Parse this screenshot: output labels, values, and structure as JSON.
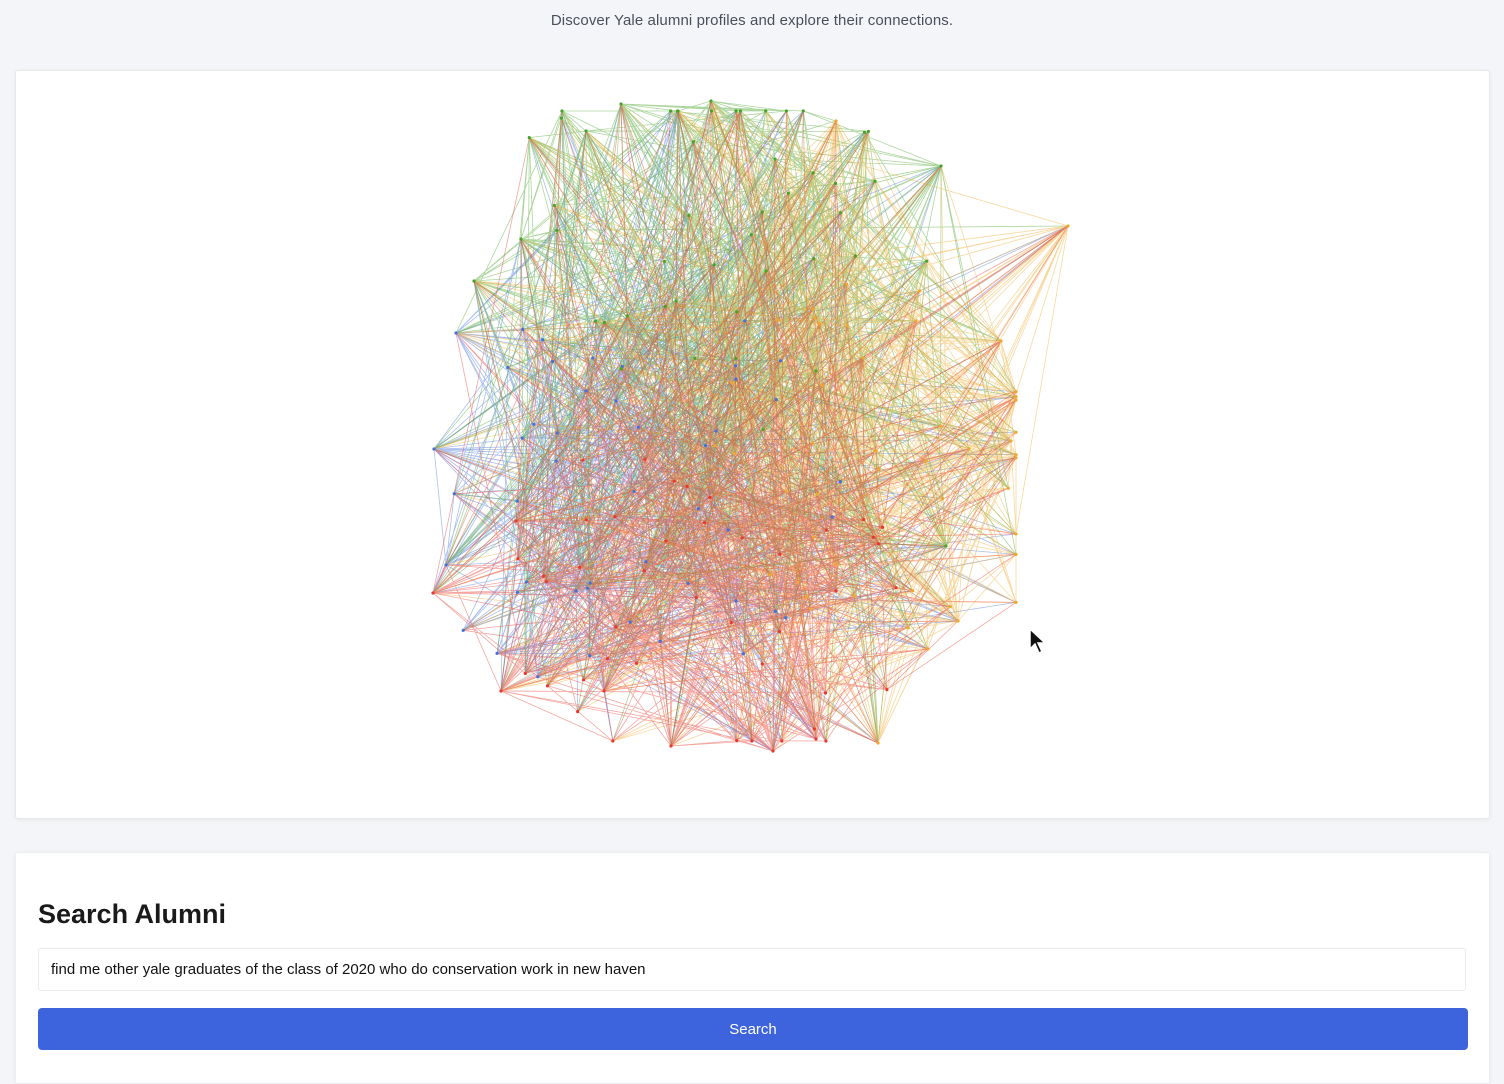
{
  "header": {
    "subtitle": "Discover Yale alumni profiles and explore their connections."
  },
  "graph": {
    "cluster_colors": [
      "#4aa329",
      "#4472dd",
      "#e8392e",
      "#f0a82a"
    ]
  },
  "search": {
    "title": "Search Alumni",
    "query_value": "find me other yale graduates of the class of 2020 who do conservation work in new haven",
    "button_label": "Search"
  }
}
